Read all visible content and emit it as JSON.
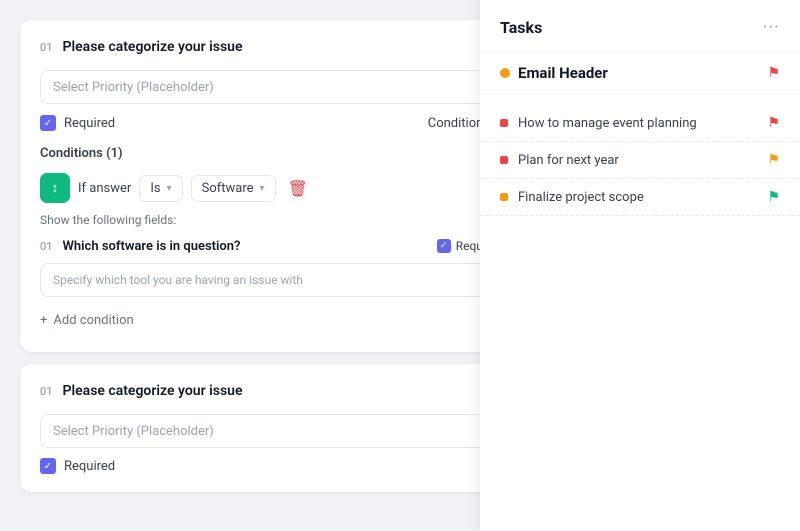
{
  "main": {
    "card1": {
      "step": "01",
      "title": "Please categorize your issue",
      "input_placeholder": "Select Priority (Placeholder)",
      "required_label": "Required",
      "conditions_label": "Conditions",
      "conditions_count": "Conditions (1)",
      "condition_if": "If answer",
      "condition_is": "Is",
      "condition_value": "Software",
      "show_fields_label": "Show the following fields:",
      "sub_step": "01",
      "sub_title": "Which software is in question?",
      "sub_required": "Required",
      "sub_placeholder": "Specify which tool you are having an issue with",
      "add_condition": "Add condition"
    },
    "card2": {
      "step": "01",
      "title": "Please categorize your issue",
      "input_placeholder": "Select Priority (Placeholder)",
      "required_label": "Required"
    }
  },
  "tasks_panel": {
    "title": "Tasks",
    "email_header": "Email Header",
    "tasks": [
      {
        "text": "How to manage event planning",
        "flag": "red"
      },
      {
        "text": "Plan for next year",
        "flag": "yellow"
      },
      {
        "text": "Finalize project scope",
        "flag": "green"
      }
    ]
  },
  "icons": {
    "dots": "···",
    "edit": "✎",
    "checkmark": "✓",
    "chevron": "▾",
    "delete": "🗑",
    "plus": "+",
    "condition_icon": "↕",
    "flag": "⚑"
  }
}
